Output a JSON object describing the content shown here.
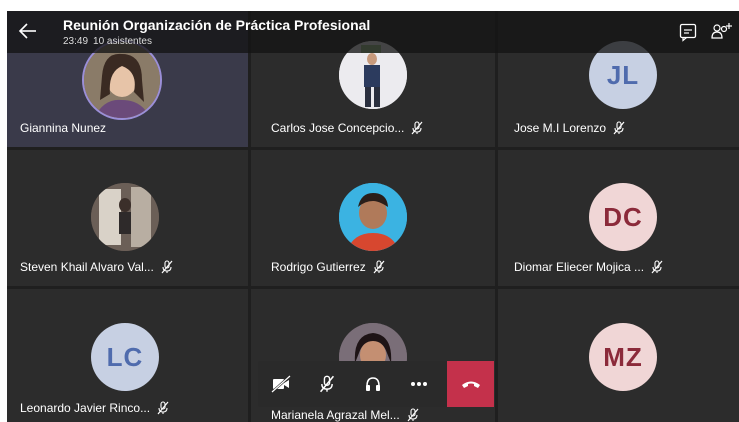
{
  "header": {
    "title": "Reunión Organización de Práctica Profesional",
    "time": "23:49",
    "attendees": "10 asistentes"
  },
  "participants": [
    {
      "name": "Giannina Nunez",
      "initials": "",
      "muted": false
    },
    {
      "name": "Carlos Jose Concepcio...",
      "initials": "",
      "muted": true
    },
    {
      "name": "Jose M.I Lorenzo",
      "initials": "JL",
      "muted": true
    },
    {
      "name": "Steven Khail Alvaro Val...",
      "initials": "",
      "muted": true
    },
    {
      "name": "Rodrigo  Gutierrez",
      "initials": "",
      "muted": true
    },
    {
      "name": "Diomar Eliecer Mojica ...",
      "initials": "DC",
      "muted": true
    },
    {
      "name": "Leonardo Javier Rinco...",
      "initials": "LC",
      "muted": true
    },
    {
      "name": "Marianela Agrazal Mel...",
      "initials": "",
      "muted": true
    },
    {
      "name": "",
      "initials": "MZ",
      "muted": false
    }
  ],
  "colors": {
    "avatar_blue_bg": "#c7d0e3",
    "avatar_blue_fg": "#4f6bad",
    "avatar_pink_bg": "#f0d6d6",
    "avatar_pink_fg": "#8b2a3a",
    "hangup": "#c4314b",
    "active_ring": "#9b8fd8"
  },
  "icons": [
    "back-arrow-icon",
    "chat-icon",
    "add-people-icon",
    "camera-off-icon",
    "mic-off-icon",
    "speaker-icon",
    "more-icon",
    "hang-up-icon"
  ]
}
